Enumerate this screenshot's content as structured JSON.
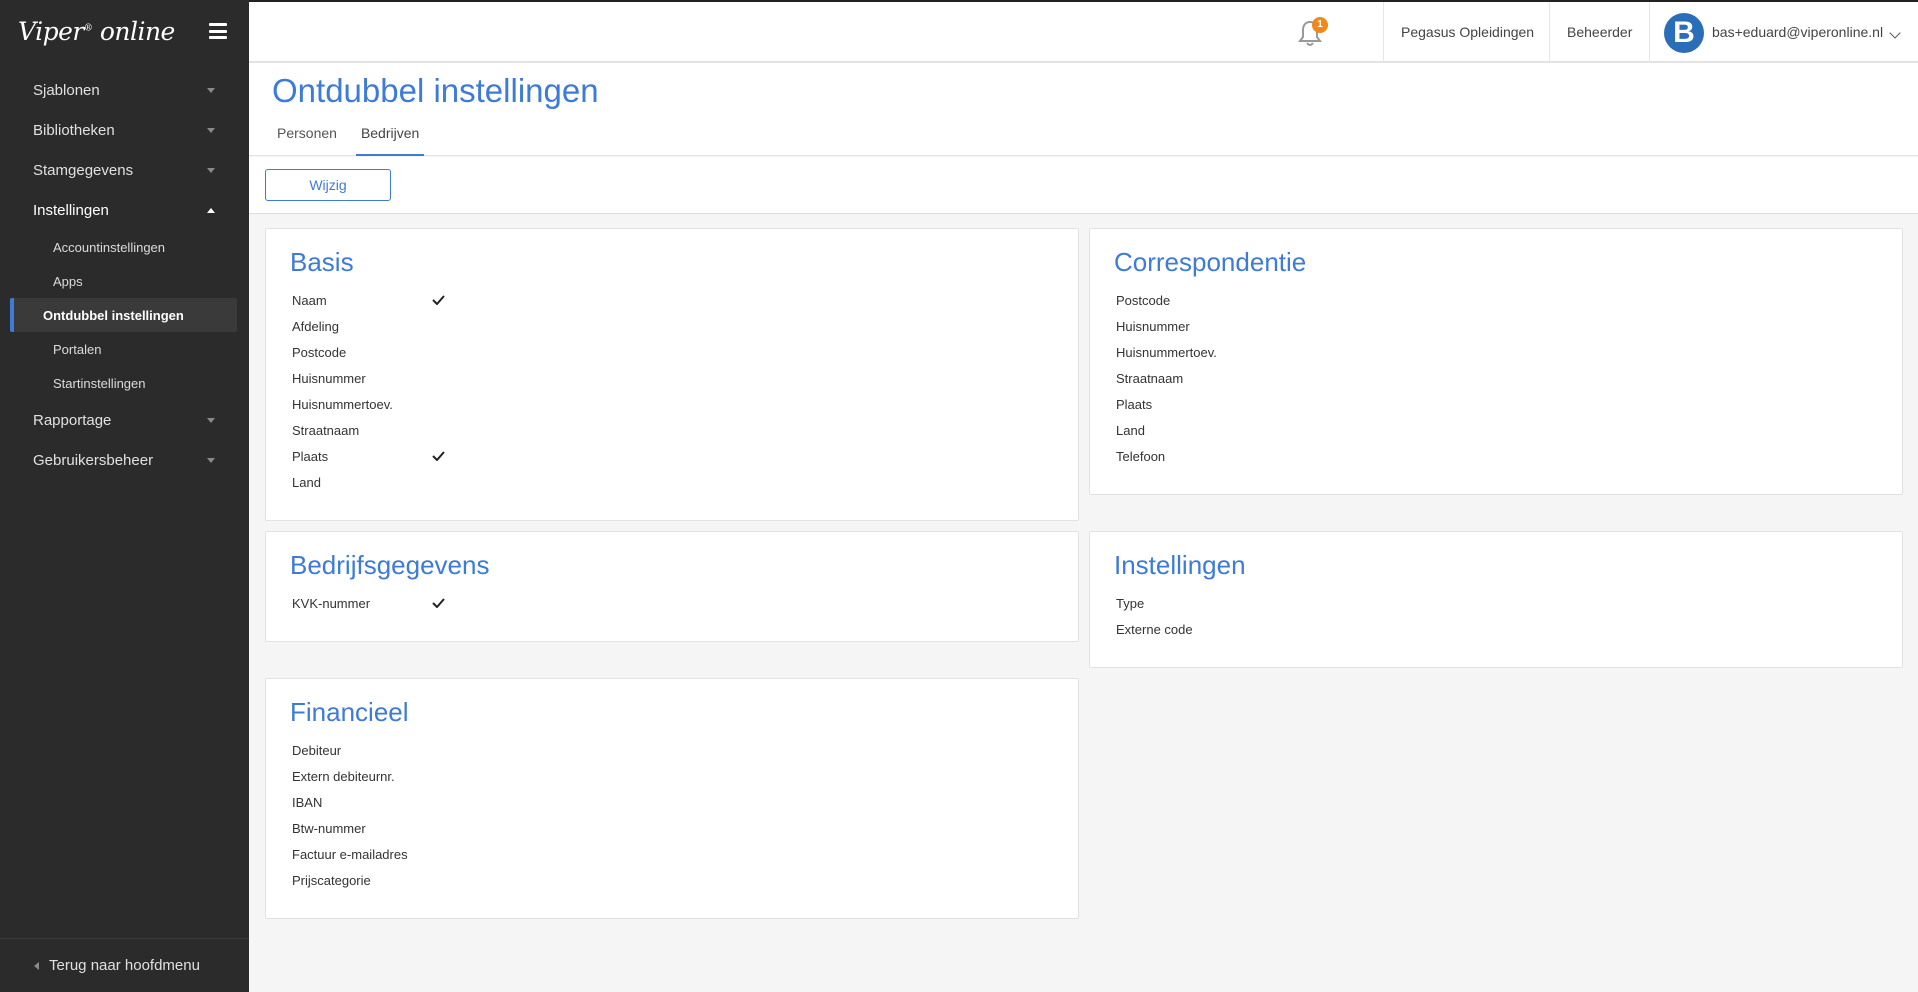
{
  "app": {
    "logo": "Viper",
    "logo_mark": "®",
    "logo_suffix": "online"
  },
  "sidebar": {
    "items": [
      {
        "label": "Sjablonen"
      },
      {
        "label": "Bibliotheken"
      },
      {
        "label": "Stamgegevens"
      },
      {
        "label": "Instellingen"
      },
      {
        "label": "Rapportage"
      },
      {
        "label": "Gebruikersbeheer"
      }
    ],
    "subitems": [
      {
        "label": "Accountinstellingen"
      },
      {
        "label": "Apps"
      },
      {
        "label": "Ontdubbel instellingen"
      },
      {
        "label": "Portalen"
      },
      {
        "label": "Startinstellingen"
      }
    ],
    "footer": "Terug naar hoofdmenu"
  },
  "topbar": {
    "notification_count": "1",
    "organization": "Pegasus Opleidingen",
    "role": "Beheerder",
    "avatar_letter": "B",
    "user_email": "bas+eduard@viperonline.nl"
  },
  "page": {
    "title": "Ontdubbel instellingen",
    "tabs": [
      {
        "label": "Personen"
      },
      {
        "label": "Bedrijven"
      }
    ],
    "edit_button": "Wijzig"
  },
  "cards": {
    "basis": {
      "title": "Basis",
      "fields": [
        {
          "label": "Naam",
          "checked": true
        },
        {
          "label": "Afdeling",
          "checked": false
        },
        {
          "label": "Postcode",
          "checked": false
        },
        {
          "label": "Huisnummer",
          "checked": false
        },
        {
          "label": "Huisnummertoev.",
          "checked": false
        },
        {
          "label": "Straatnaam",
          "checked": false
        },
        {
          "label": "Plaats",
          "checked": true
        },
        {
          "label": "Land",
          "checked": false
        }
      ]
    },
    "correspondentie": {
      "title": "Correspondentie",
      "fields": [
        {
          "label": "Postcode",
          "checked": false
        },
        {
          "label": "Huisnummer",
          "checked": false
        },
        {
          "label": "Huisnummertoev.",
          "checked": false
        },
        {
          "label": "Straatnaam",
          "checked": false
        },
        {
          "label": "Plaats",
          "checked": false
        },
        {
          "label": "Land",
          "checked": false
        },
        {
          "label": "Telefoon",
          "checked": false
        }
      ]
    },
    "bedrijfsgegevens": {
      "title": "Bedrijfsgegevens",
      "fields": [
        {
          "label": "KVK-nummer",
          "checked": true
        }
      ]
    },
    "instellingen": {
      "title": "Instellingen",
      "fields": [
        {
          "label": "Type",
          "checked": false
        },
        {
          "label": "Externe code",
          "checked": false
        }
      ]
    },
    "financieel": {
      "title": "Financieel",
      "fields": [
        {
          "label": "Debiteur",
          "checked": false
        },
        {
          "label": "Extern debiteurnr.",
          "checked": false
        },
        {
          "label": "IBAN",
          "checked": false
        },
        {
          "label": "Btw-nummer",
          "checked": false
        },
        {
          "label": "Factuur e-mailadres",
          "checked": false
        },
        {
          "label": "Prijscategorie",
          "checked": false
        }
      ]
    }
  },
  "colors": {
    "accent": "#3d7bd6",
    "sidebar_bg": "#2b2b2b",
    "badge": "#f0881b"
  }
}
